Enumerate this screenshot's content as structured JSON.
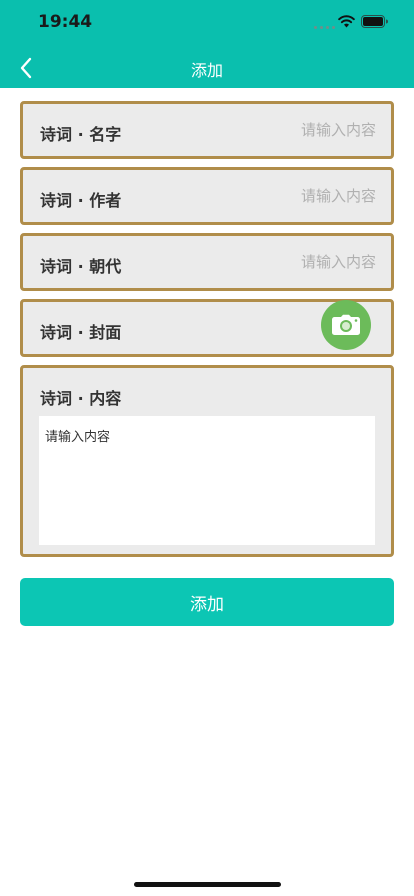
{
  "status_bar": {
    "time": "19:44"
  },
  "nav": {
    "title": "添加",
    "back_icon": "chevron-left-icon"
  },
  "form": {
    "name": {
      "label": "诗词 · 名字",
      "placeholder": "请输入内容"
    },
    "author": {
      "label": "诗词 · 作者",
      "placeholder": "请输入内容"
    },
    "dynasty": {
      "label": "诗词 · 朝代",
      "placeholder": "请输入内容"
    },
    "cover": {
      "label": "诗词 · 封面",
      "icon": "camera-icon"
    },
    "content": {
      "label": "诗词 · 内容",
      "placeholder": "请输入内容"
    }
  },
  "submit_label": "添加",
  "colors": {
    "header": "#0ABFAE",
    "field_border": "#B08D4A",
    "field_bg": "#EBEBEB",
    "camera_button": "#6CBB5A",
    "submit_button": "#0CC6B4"
  }
}
